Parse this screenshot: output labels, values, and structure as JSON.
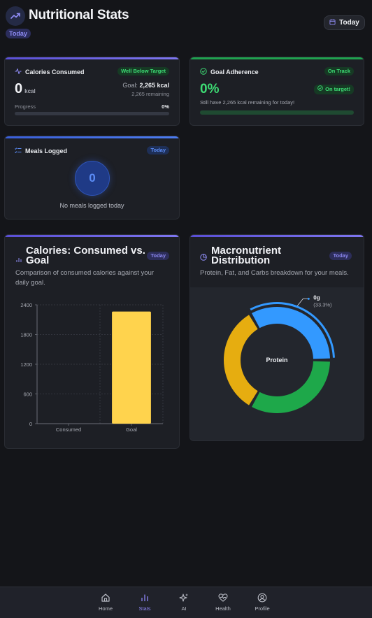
{
  "header": {
    "title": "Nutritional Stats",
    "badge": "Today",
    "date_button": "Today"
  },
  "calories_card": {
    "title": "Calories Consumed",
    "status": "Well Below Target",
    "value": "0",
    "unit": "kcal",
    "goal_prefix": "Goal:",
    "goal_value": "2,265 kcal",
    "remaining": "2,265 remaining",
    "progress_label": "Progress",
    "progress_value": "0%",
    "progress_fraction": 0
  },
  "goal_card": {
    "title": "Goal Adherence",
    "status": "On Track",
    "value": "0%",
    "badge": "On target!",
    "message": "Still have 2,265 kcal remaining for today!",
    "progress_fraction": 0
  },
  "meals_card": {
    "title": "Meals Logged",
    "badge": "Today",
    "count": "0",
    "empty_text": "No meals logged today"
  },
  "calories_chart_card": {
    "title_line1": "Calories: Consumed vs.",
    "title_line2": "Goal",
    "badge": "Today",
    "desc_line1": "Comparison of consumed calories against your",
    "desc_line2": "daily goal."
  },
  "macro_card": {
    "title_line1": "Macronutrient",
    "title_line2": "Distribution",
    "badge": "Today",
    "desc": "Protein, Fat, and Carbs breakdown for your meals.",
    "center_label": "Protein",
    "callout_value": "0g",
    "callout_pct": "(33.3%)"
  },
  "chart_data": [
    {
      "type": "bar",
      "categories": [
        "Consumed",
        "Goal"
      ],
      "values": [
        0,
        2265
      ],
      "ylim": [
        0,
        2400
      ],
      "yticks": [
        "0",
        "600",
        "1200",
        "1800",
        "2400"
      ],
      "grid": true,
      "colors": [
        "#ffd34d",
        "#ffd34d"
      ]
    },
    {
      "type": "pie",
      "labels": [
        "Protein",
        "Carbs",
        "Fat"
      ],
      "values": [
        33.3,
        33.3,
        33.3
      ],
      "colors": [
        "#3399ff",
        "#1ea84a",
        "#e6ad10"
      ],
      "highlighted": "Protein"
    }
  ],
  "nav": {
    "items": [
      {
        "label": "Home",
        "icon": "home-icon"
      },
      {
        "label": "Stats",
        "icon": "bar-chart-icon",
        "active": true
      },
      {
        "label": "AI",
        "icon": "sparkles-icon"
      },
      {
        "label": "Health",
        "icon": "heart-pulse-icon"
      },
      {
        "label": "Profile",
        "icon": "user-circle-icon"
      }
    ]
  },
  "colors": {
    "background": "#141519",
    "card": "#1d1f25",
    "accent": "#7e76f0",
    "success": "#3ddc74",
    "bar": "#ffd34d"
  }
}
